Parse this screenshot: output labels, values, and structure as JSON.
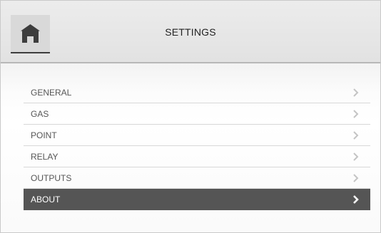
{
  "header": {
    "title": "SETTINGS",
    "home_icon": "home-icon"
  },
  "menu": {
    "items": [
      {
        "label": "GENERAL",
        "icon": "chevron-right-icon",
        "selected": false
      },
      {
        "label": "GAS",
        "icon": "chevron-right-icon",
        "selected": false
      },
      {
        "label": "POINT",
        "icon": "chevron-right-icon",
        "selected": false
      },
      {
        "label": "RELAY",
        "icon": "chevron-right-icon",
        "selected": false
      },
      {
        "label": "OUTPUTS",
        "icon": "chevron-right-icon",
        "selected": false
      },
      {
        "label": "ABOUT",
        "icon": "chevron-right-icon",
        "selected": true
      }
    ]
  },
  "colors": {
    "selected_bg": "#555555",
    "chevron": "#c4c4c4",
    "chevron_selected": "#ffffff"
  }
}
